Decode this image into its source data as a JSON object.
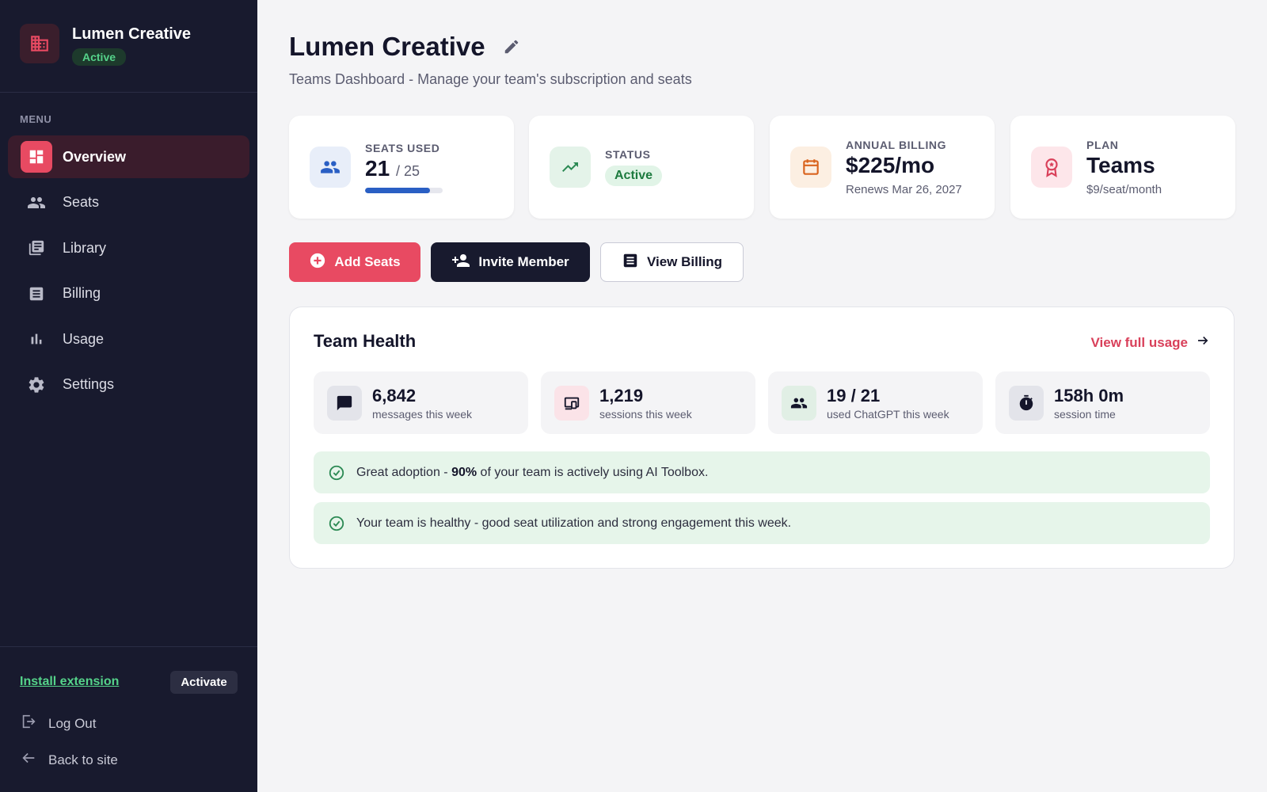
{
  "sidebar": {
    "brand_name": "Lumen Creative",
    "brand_status": "Active",
    "menu_title": "MENU",
    "items": [
      {
        "label": "Overview",
        "icon": "dashboard-icon",
        "active": true
      },
      {
        "label": "Seats",
        "icon": "people-icon",
        "active": false
      },
      {
        "label": "Library",
        "icon": "library-icon",
        "active": false
      },
      {
        "label": "Billing",
        "icon": "receipt-icon",
        "active": false
      },
      {
        "label": "Usage",
        "icon": "bar-chart-icon",
        "active": false
      },
      {
        "label": "Settings",
        "icon": "gear-icon",
        "active": false
      }
    ],
    "install_extension": "Install extension",
    "activate": "Activate",
    "logout": "Log Out",
    "back_to_site": "Back to site"
  },
  "header": {
    "title": "Lumen Creative",
    "subtitle": "Teams Dashboard - Manage your team's subscription and seats"
  },
  "stats": {
    "seats": {
      "label": "SEATS USED",
      "used": "21",
      "total": "/ 25",
      "fraction": 0.84
    },
    "status": {
      "label": "STATUS",
      "value": "Active"
    },
    "billing": {
      "label": "ANNUAL BILLING",
      "value": "$225/mo",
      "sub": "Renews Mar 26, 2027"
    },
    "plan": {
      "label": "PLAN",
      "value": "Teams",
      "sub": "$9/seat/month"
    }
  },
  "actions": {
    "add_seats": "Add Seats",
    "invite_member": "Invite Member",
    "view_billing": "View Billing"
  },
  "health": {
    "title": "Team Health",
    "view_full_usage": "View full usage",
    "metrics": [
      {
        "value": "6,842",
        "label": "messages this week",
        "icon": "chat-icon"
      },
      {
        "value": "1,219",
        "label": "sessions this week",
        "icon": "devices-icon"
      },
      {
        "value": "19 / 21",
        "label": "used ChatGPT this week",
        "icon": "people-icon"
      },
      {
        "value": "158h 0m",
        "label": "session time",
        "icon": "stopwatch-icon"
      }
    ],
    "alert1": {
      "prefix": "Great adoption - ",
      "bold": "90%",
      "suffix": " of your team is actively using AI Toolbox."
    },
    "alert2": "Your team is healthy - good seat utilization and strong engagement this week."
  },
  "colors": {
    "sidebar_bg": "#181a2e",
    "accent": "#e84a62",
    "success": "#55d38a",
    "progress": "#2a5fc4"
  }
}
